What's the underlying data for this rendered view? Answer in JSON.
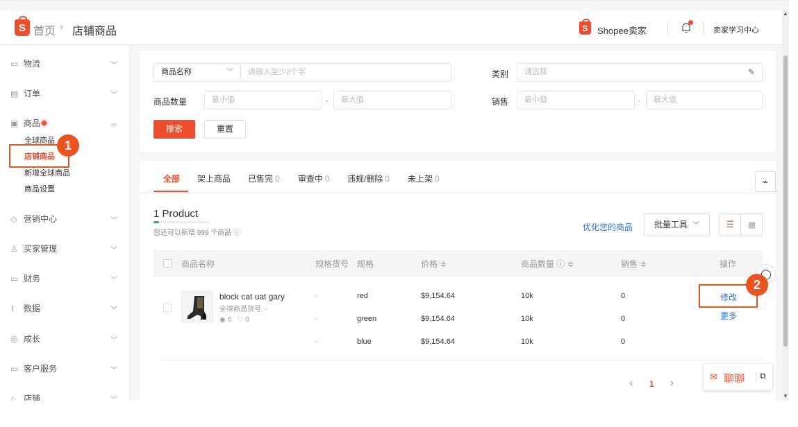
{
  "topbar": {
    "logo_letter": "S",
    "breadcrumb_home": "首页",
    "breadcrumb_sep": "›",
    "breadcrumb_current": "店铺商品",
    "seller_brand": "Shopee卖家",
    "learning_center": "卖家学习中心"
  },
  "sidebar": {
    "items": [
      {
        "icon": "truck-icon",
        "label": "物流"
      },
      {
        "icon": "order-icon",
        "label": "订单"
      },
      {
        "icon": "product-icon",
        "label": "商品"
      },
      {
        "icon": "marketing-icon",
        "label": "营销中心"
      },
      {
        "icon": "buyer-icon",
        "label": "买家管理"
      },
      {
        "icon": "finance-icon",
        "label": "财务"
      },
      {
        "icon": "data-icon",
        "label": "数据"
      },
      {
        "icon": "growth-icon",
        "label": "成长"
      },
      {
        "icon": "service-icon",
        "label": "客户服务"
      },
      {
        "icon": "shop-icon",
        "label": "店铺"
      }
    ],
    "product_sub": [
      "全球商品",
      "店铺商品",
      "新增全球商品",
      "商品设置"
    ]
  },
  "filters": {
    "name_select": "商品名称",
    "name_placeholder": "请输入至少2个字",
    "category_label": "类别",
    "category_placeholder": "请选择",
    "quantity_label": "商品数量",
    "sales_label": "销售",
    "min_placeholder": "最小值",
    "max_placeholder": "最大值",
    "range_sep": "-",
    "search_button": "搜索",
    "reset_button": "重置"
  },
  "tabs": [
    {
      "label": "全部",
      "count": ""
    },
    {
      "label": "架上商品",
      "count": ""
    },
    {
      "label": "已售完",
      "count": "0"
    },
    {
      "label": "审查中",
      "count": "0"
    },
    {
      "label": "违规/删除",
      "count": "0"
    },
    {
      "label": "未上架",
      "count": "0"
    }
  ],
  "list": {
    "count_title": "1 Product",
    "quota_text": "您还可以新增 999 个商品",
    "optimize_link": "优化您的商品",
    "bulk_tools": "批量工具",
    "columns": [
      "商品名称",
      "规格货号",
      "规格",
      "价格 ≑",
      "商品数量 ⓘ ≑",
      "销售 ≑",
      "操作"
    ],
    "product": {
      "name": "block cat uat gary",
      "global_sku": "全球商品货号: -",
      "views": "0",
      "likes": "0",
      "variants": [
        {
          "sku": "-",
          "spec": "red",
          "price": "$9,154.64",
          "qty": "10k",
          "sales": "0"
        },
        {
          "sku": "-",
          "spec": "green",
          "price": "$9,154.64",
          "qty": "10k",
          "sales": "0"
        },
        {
          "sku": "-",
          "spec": "blue",
          "price": "$9,154.64",
          "qty": "10k",
          "sales": "0"
        }
      ],
      "edit_action": "修改",
      "more_action": "更多"
    },
    "pagination": {
      "prev": "‹",
      "current": "1",
      "next": "›"
    }
  },
  "chat": {
    "label": "聊聊"
  },
  "annotations": {
    "step1": "1",
    "step2": "2"
  },
  "colors": {
    "brand": "#ee4d2d",
    "link": "#2673dd",
    "annotation": "#e8541f"
  }
}
